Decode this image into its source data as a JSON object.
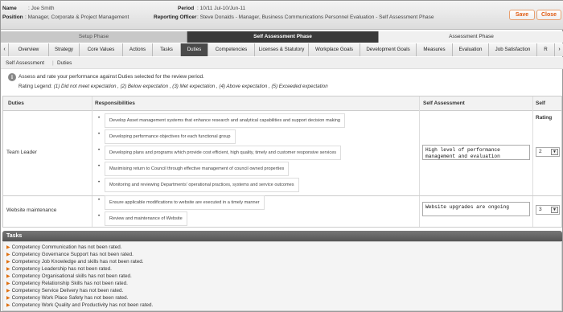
{
  "header": {
    "name_label": "Name",
    "name_value": ": Joe Smith",
    "position_label": "Position",
    "position_value": ": Manager, Corporate & Project Management",
    "period_label": "Period",
    "period_value": ": 10/11 Jul-10/Jun-11",
    "officer_label": "Reporting Officer",
    "officer_value": ": Steve Donalds - Manager, Business Communications Personnel Evaluation - Self Assessment Phase",
    "save_label": "Save",
    "close_label": "Close"
  },
  "phases": [
    {
      "label": "Setup Phase",
      "state": "done"
    },
    {
      "label": "Self Assessment Phase",
      "state": "current"
    },
    {
      "label": "Assessment Phase",
      "state": "future"
    }
  ],
  "tabs": [
    "Overview",
    "Strategy",
    "Core Values",
    "Actions",
    "Tasks",
    "Duties",
    "Competencies",
    "Licenses & Statutory",
    "Workplace Goals",
    "Development Goals",
    "Measures",
    "Evaluation",
    "Job Satisfaction",
    "R"
  ],
  "active_tab": "Duties",
  "breadcrumb": [
    "Self Assessment",
    "Duties"
  ],
  "info_text": "Assess and rate your performance against Duties selected for the review period.",
  "legend_label": "Rating Legend:",
  "legend_text": "(1) Did not meet expectation , (2) Below expectation , (3) Met expectation , (4) Above expectation , (5) Exceeded expectation",
  "table": {
    "headers": [
      "Duties",
      "Responsibilities",
      "Self Assessment",
      "Self Rating"
    ],
    "rows": [
      {
        "duty": "Team Leader",
        "responsibilities": [
          "Develop Asset management systems that enhance research and analytical capabilities and support decision making",
          "Developing performance objectives for each functional group",
          "Developing plans and programs which provide cost efficient, high quality, timely and customer responsive services",
          "Maximising return to Council through effective management of council owned properties",
          "Monitoring and reviewing Departments' operational practices, systems and service outcomes"
        ],
        "self_assessment": "High level of performance management and evaluation",
        "rating": "2"
      },
      {
        "duty": "Website maintenance",
        "responsibilities": [
          "Ensure applicable modifications to website are executed in a timely manner",
          "Review and maintenance of Website"
        ],
        "self_assessment": "Website upgrades are ongoing",
        "rating": "3"
      }
    ]
  },
  "tasks": {
    "title": "Tasks",
    "items": [
      "Competency Communication has not been rated.",
      "Competency Governance Support has not been rated.",
      "Competency Job Knowledge and skills has not been rated.",
      "Competency Leadership has not been rated.",
      "Competency Organisational skills has not been rated.",
      "Competency Relationship Skills has not been rated.",
      "Competency Service Delivery has not been rated.",
      "Competency Work Place Safety has not been rated.",
      "Competency Work Quality and Productivity has not been rated."
    ]
  },
  "colors": {
    "accent": "#e05a10",
    "active_tab": "#4a4a4a",
    "phase_current": "#3a3a3a",
    "task_arrow": "#e07010"
  }
}
